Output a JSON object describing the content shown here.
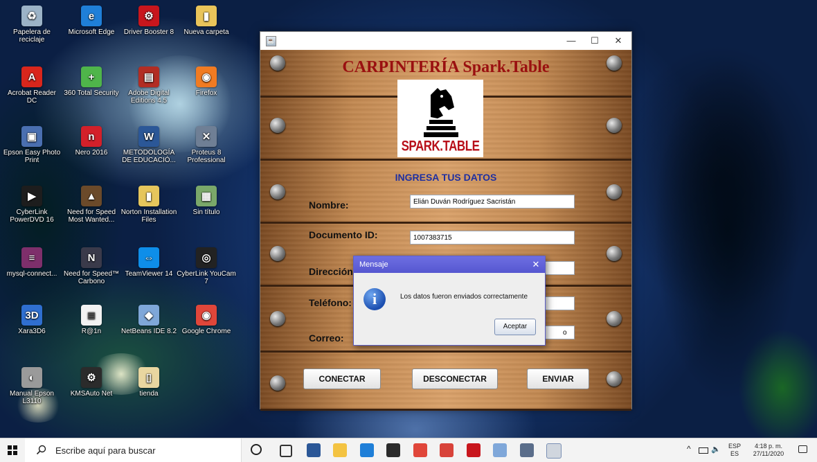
{
  "desktop": {
    "icons": [
      {
        "label": "Papelera de reciclaje",
        "icon": "recycle-bin-icon",
        "color": "#9cb3c7",
        "glyph": "♻"
      },
      {
        "label": "Microsoft Edge",
        "icon": "edge-icon",
        "color": "#1f7fd8",
        "glyph": "e"
      },
      {
        "label": "Driver Booster 8",
        "icon": "driver-booster-icon",
        "color": "#c8161d",
        "glyph": "⚙"
      },
      {
        "label": "Nueva carpeta",
        "icon": "folder-icon",
        "color": "#e9c45a",
        "glyph": "▮"
      },
      {
        "label": "Acrobat Reader DC",
        "icon": "acrobat-icon",
        "color": "#d9261c",
        "glyph": "A"
      },
      {
        "label": "360 Total Security",
        "icon": "security-icon",
        "color": "#4fb54a",
        "glyph": "+"
      },
      {
        "label": "Adobe Digital Editions 4.5",
        "icon": "adobe-de-icon",
        "color": "#b22d24",
        "glyph": "▤"
      },
      {
        "label": "Firefox",
        "icon": "firefox-icon",
        "color": "#f07b22",
        "glyph": "◉"
      },
      {
        "label": "Epson Easy Photo Print",
        "icon": "epson-icon",
        "color": "#4a6fb0",
        "glyph": "▣"
      },
      {
        "label": "Nero 2016",
        "icon": "nero-icon",
        "color": "#d3202a",
        "glyph": "n"
      },
      {
        "label": "METODOLOGÍA DE EDUCACIÓ...",
        "icon": "word-doc-icon",
        "color": "#2b5797",
        "glyph": "W"
      },
      {
        "label": "Proteus 8 Professional",
        "icon": "proteus-icon",
        "color": "#6f7f95",
        "glyph": "✕"
      },
      {
        "label": "CyberLink PowerDVD 16",
        "icon": "powerdvd-icon",
        "color": "#1d1d1d",
        "glyph": "▶"
      },
      {
        "label": "Need for Speed Most Wanted...",
        "icon": "nfs-icon",
        "color": "#6b4a2a",
        "glyph": "▲"
      },
      {
        "label": "Norton Installation Files",
        "icon": "norton-folder-icon",
        "color": "#e6c65c",
        "glyph": "▮"
      },
      {
        "label": "Sin título",
        "icon": "image-file-icon",
        "color": "#7aa86a",
        "glyph": "▦"
      },
      {
        "label": "mysql-connect...",
        "icon": "winrar-icon",
        "color": "#7e2f6b",
        "glyph": "≡"
      },
      {
        "label": "Need for Speed™ Carbono",
        "icon": "nfs-carbon-icon",
        "color": "#3a3a4a",
        "glyph": "N"
      },
      {
        "label": "TeamViewer 14",
        "icon": "teamviewer-icon",
        "color": "#0e8ee9",
        "glyph": "⇔"
      },
      {
        "label": "CyberLink YouCam 7",
        "icon": "youcam-icon",
        "color": "#222222",
        "glyph": "◎"
      },
      {
        "label": "Xara3D6",
        "icon": "xara-icon",
        "color": "#2f6fd0",
        "glyph": "3D"
      },
      {
        "label": "R@1n",
        "icon": "text-file-icon",
        "color": "#f2f2f2",
        "glyph": "≣"
      },
      {
        "label": "NetBeans IDE 8.2",
        "icon": "netbeans-icon",
        "color": "#7fa7d9",
        "glyph": "◆"
      },
      {
        "label": "Google Chrome",
        "icon": "chrome-icon",
        "color": "#e0463a",
        "glyph": "◉"
      },
      {
        "label": "Manual Epson L3110",
        "icon": "manual-icon",
        "color": "#9a9a9a",
        "glyph": "◐"
      },
      {
        "label": "KMSAuto Net",
        "icon": "kmsauto-icon",
        "color": "#2b2b2b",
        "glyph": "⚙"
      },
      {
        "label": "tienda",
        "icon": "tienda-icon",
        "color": "#e9d6a0",
        "glyph": "▯"
      }
    ]
  },
  "window": {
    "title": "",
    "controls": {
      "minimize": "—",
      "maximize": "☐",
      "close": "✕"
    },
    "app_title": "CARPINTERÍA Spark.Table",
    "logo_text": "SPARK.TABLE",
    "section_title": "INGRESA TUS DATOS",
    "form": {
      "nombre_label": "Nombre:",
      "nombre_value": "Elián Duván Rodríguez Sacristán",
      "documento_label": "Documento ID:",
      "documento_value": "1007383715",
      "direccion_label": "Dirección:",
      "direccion_value": "",
      "telefono_label": "Teléfono:",
      "telefono_value": "",
      "correo_label": "Correo:",
      "correo_value": "o"
    },
    "buttons": {
      "connect": "CONECTAR",
      "disconnect": "DESCONECTAR",
      "send": "ENVIAR"
    }
  },
  "dialog": {
    "title": "Mensaje",
    "close": "✕",
    "message": "Los datos fueron enviados correctamente",
    "ok": "Aceptar"
  },
  "taskbar": {
    "search_placeholder": "Escribe aquí para buscar",
    "apps": [
      "task-view-icon",
      "word-icon",
      "file-explorer-icon",
      "edge-icon",
      "store-icon",
      "chrome-icon",
      "media-icon",
      "driver-booster-icon",
      "paint-icon",
      "netbeans-icon",
      "java-app-icon"
    ],
    "tray": {
      "language_top": "ESP",
      "language_bottom": "ES",
      "time": "4:18 p. m.",
      "date": "27/11/2020",
      "chevron": "^"
    }
  }
}
